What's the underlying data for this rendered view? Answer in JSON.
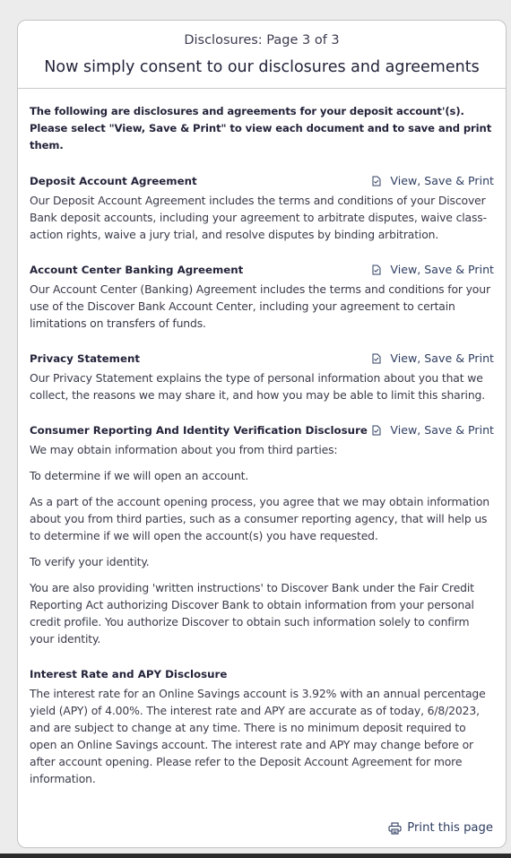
{
  "header": {
    "page_indicator": "Disclosures: Page 3 of 3",
    "heading": "Now simply consent to our disclosures and agreements"
  },
  "intro": "The following are disclosures and agreements for your deposit account'(s). Please select \"View, Save & Print\" to view each document and to save and print them.",
  "link_label": "View, Save & Print",
  "sections": [
    {
      "title": "Deposit Account Agreement",
      "paragraphs": [
        "Our Deposit Account Agreement includes the terms and conditions of your Discover Bank deposit accounts, including your agreement to arbitrate disputes, waive class-action rights, waive a jury trial, and resolve disputes by binding arbitration."
      ]
    },
    {
      "title": "Account Center Banking Agreement",
      "paragraphs": [
        "Our Account Center (Banking) Agreement includes the terms and conditions for your use of the Discover Bank Account Center, including your agreement to certain limitations on transfers of funds."
      ]
    },
    {
      "title": "Privacy Statement",
      "paragraphs": [
        "Our Privacy Statement explains the type of personal information about you that we collect, the reasons we may share it, and how you may be able to limit this sharing."
      ]
    },
    {
      "title": "Consumer Reporting And Identity Verification Disclosure",
      "paragraphs": [
        "We may obtain information about you from third parties:",
        "To determine if we will open an account.",
        "As a part of the account opening process, you agree that we may obtain information about you from third parties, such as a consumer reporting agency, that will help us to determine if we will open the account(s) you have requested.",
        "To verify your identity.",
        "You are also providing 'written instructions' to Discover Bank under the Fair Credit Reporting Act authorizing Discover Bank to obtain information from your personal credit profile. You authorize Discover to obtain such information solely to confirm your identity."
      ]
    },
    {
      "title": "Interest Rate and APY Disclosure",
      "paragraphs": [
        "The interest rate for an Online Savings account is 3.92% with an annual percentage yield (APY) of 4.00%. The interest rate and APY are accurate as of today, 6/8/2023, and are subject to change at any time. There is no minimum deposit required to open an Online Savings account. The interest rate and APY may change before or after account opening. Please refer to the Deposit Account Agreement for more information."
      ]
    }
  ],
  "footer": {
    "print_label": "Print this page"
  },
  "icons": {
    "document": "document-icon",
    "print": "printer-icon"
  },
  "colors": {
    "link": "#2e3d60",
    "text": "#23233a",
    "border": "#c4c4c4"
  }
}
